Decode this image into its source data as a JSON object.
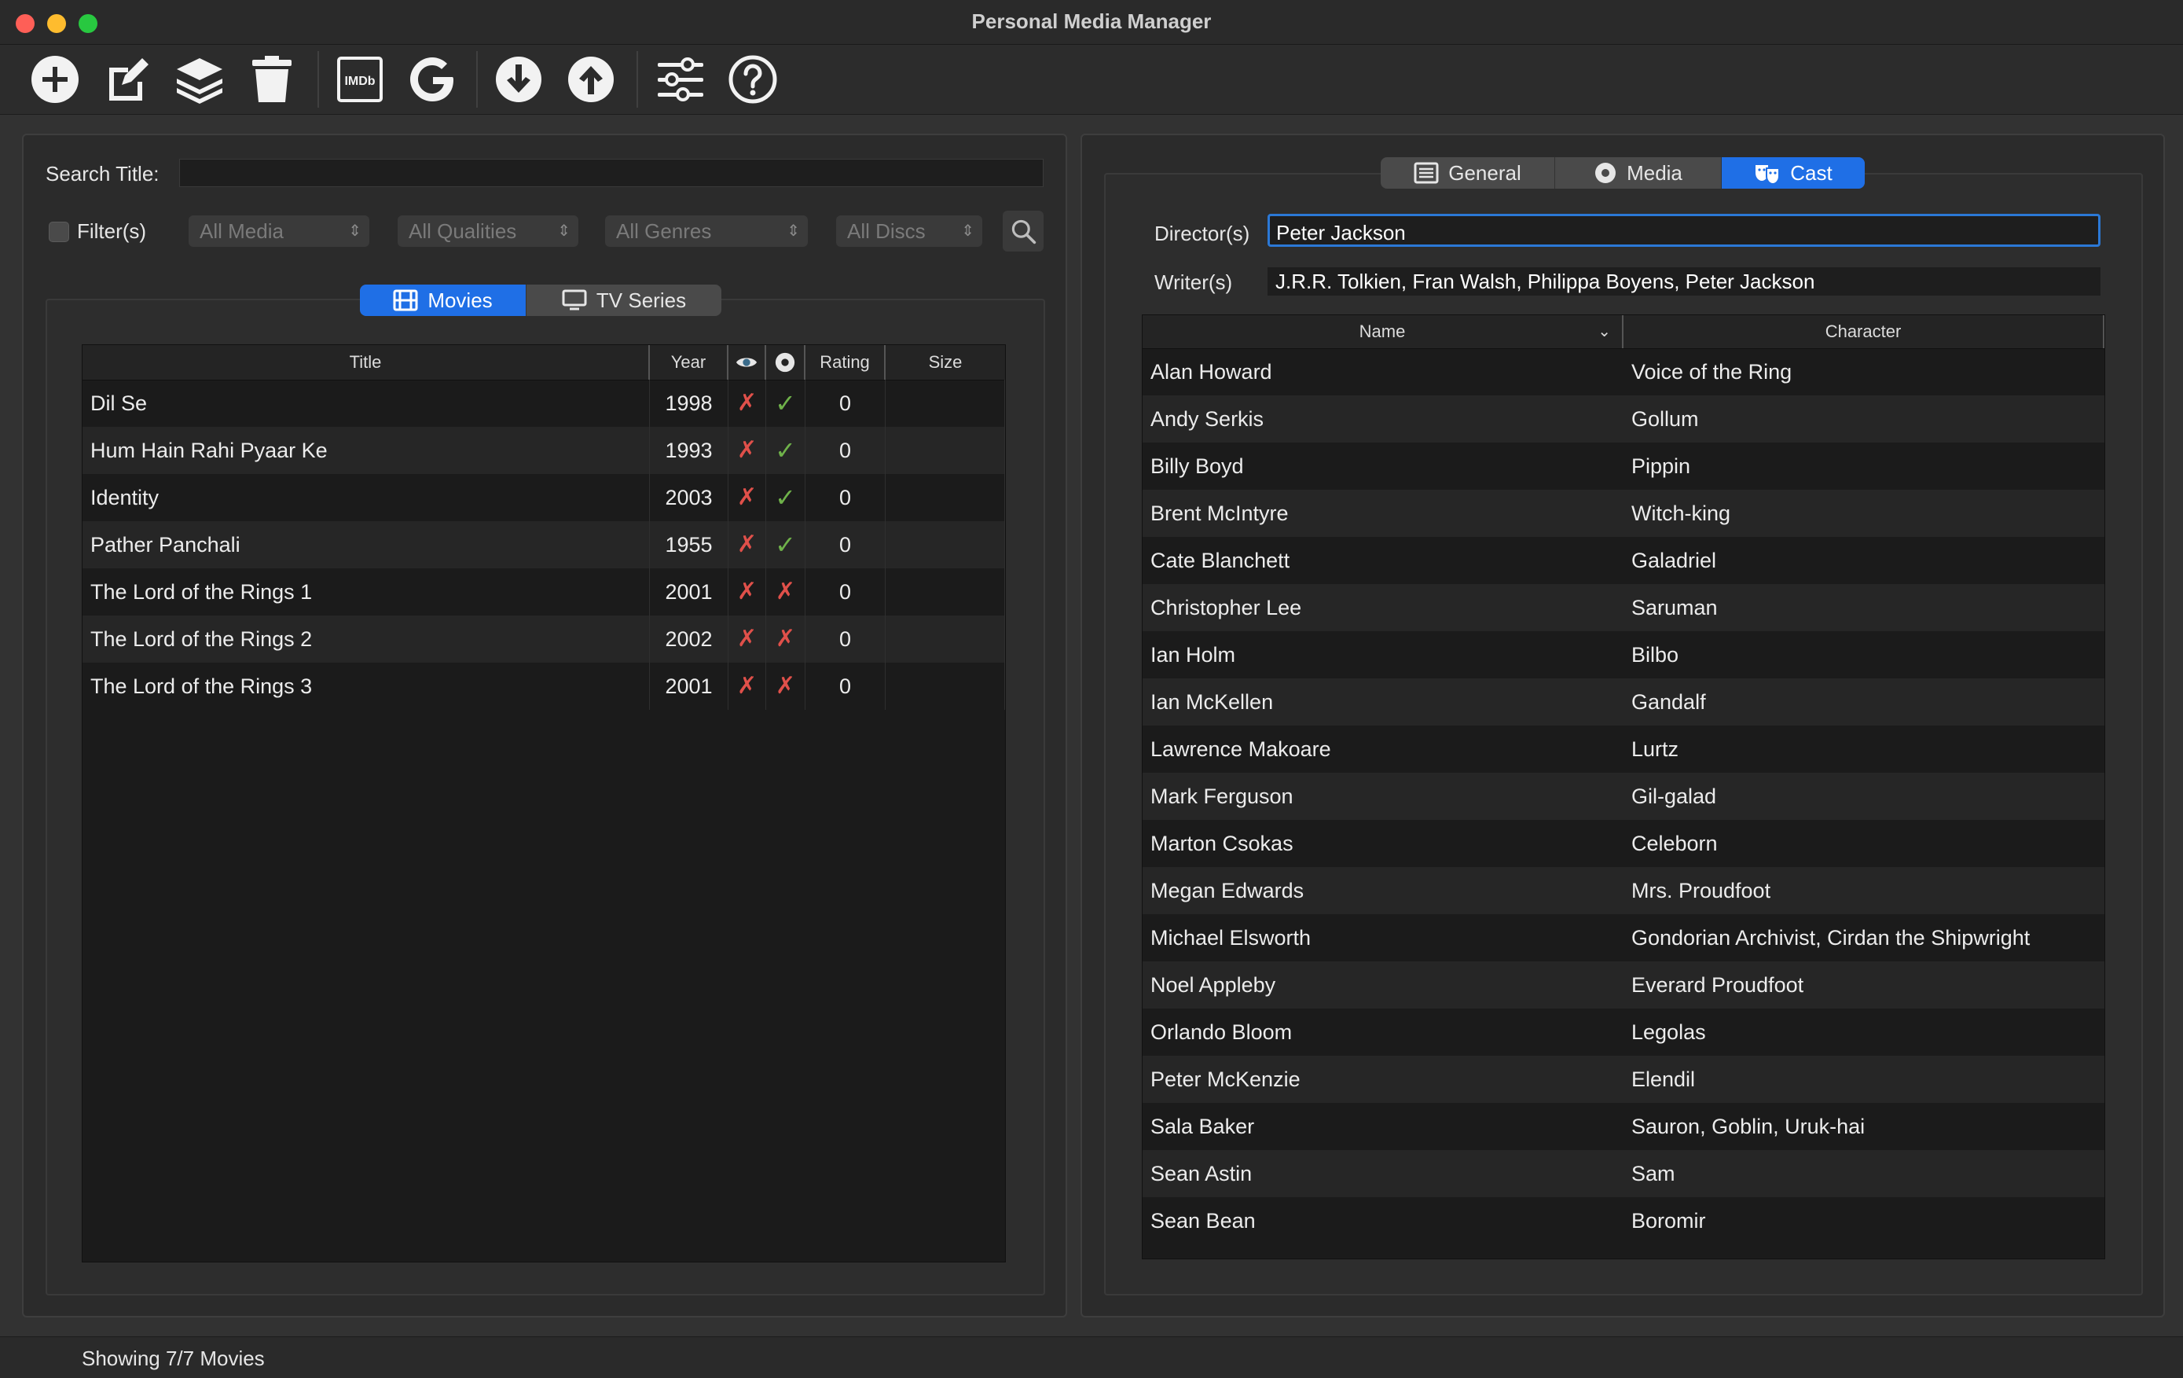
{
  "window": {
    "title": "Personal Media Manager"
  },
  "toolbar": {
    "buttons": [
      {
        "icon": "plus-circle-icon",
        "label": "Add"
      },
      {
        "icon": "edit-icon",
        "label": "Edit"
      },
      {
        "icon": "layers-icon",
        "label": "Collections"
      },
      {
        "icon": "trash-icon",
        "label": "Delete"
      },
      {
        "icon": "imdb-icon",
        "text": "IMDb"
      },
      {
        "icon": "google-icon",
        "text": "G"
      },
      {
        "icon": "download-icon",
        "label": "Download"
      },
      {
        "icon": "upload-icon",
        "label": "Upload"
      },
      {
        "icon": "sliders-icon",
        "label": "Settings"
      },
      {
        "icon": "help-icon",
        "label": "Help"
      }
    ]
  },
  "search": {
    "label": "Search Title:",
    "value": ""
  },
  "filters": {
    "label": "Filter(s)",
    "checked": false,
    "media": "All Media",
    "qualities": "All Qualities",
    "genres": "All Genres",
    "discs": "All Discs"
  },
  "library_tabs": {
    "movies": "Movies",
    "tv_series": "TV Series",
    "active": "movies"
  },
  "movie_table": {
    "headers": {
      "title": "Title",
      "year": "Year",
      "rating": "Rating",
      "size": "Size"
    },
    "rows": [
      {
        "title": "Dil Se",
        "year": "1998",
        "seen": false,
        "owned": true,
        "rating": "0",
        "size": ""
      },
      {
        "title": "Hum Hain Rahi Pyaar Ke",
        "year": "1993",
        "seen": false,
        "owned": true,
        "rating": "0",
        "size": ""
      },
      {
        "title": "Identity",
        "year": "2003",
        "seen": false,
        "owned": true,
        "rating": "0",
        "size": ""
      },
      {
        "title": "Pather Panchali",
        "year": "1955",
        "seen": false,
        "owned": true,
        "rating": "0",
        "size": ""
      },
      {
        "title": "The Lord of the Rings 1",
        "year": "2001",
        "seen": false,
        "owned": false,
        "rating": "0",
        "size": ""
      },
      {
        "title": "The Lord of the Rings 2",
        "year": "2002",
        "seen": false,
        "owned": false,
        "rating": "0",
        "size": ""
      },
      {
        "title": "The Lord of the Rings 3",
        "year": "2001",
        "seen": false,
        "owned": false,
        "rating": "0",
        "size": ""
      }
    ]
  },
  "detail_tabs": {
    "general": "General",
    "media": "Media",
    "cast": "Cast",
    "active": "cast"
  },
  "credits": {
    "directors_label": "Director(s)",
    "directors_value": "Peter Jackson",
    "writers_label": "Writer(s)",
    "writers_value": "J.R.R. Tolkien, Fran Walsh, Philippa Boyens, Peter Jackson"
  },
  "cast_table": {
    "headers": {
      "name": "Name",
      "character": "Character"
    },
    "rows": [
      {
        "name": "Alan Howard",
        "character": "Voice of the Ring"
      },
      {
        "name": "Andy Serkis",
        "character": "Gollum"
      },
      {
        "name": "Billy Boyd",
        "character": "Pippin"
      },
      {
        "name": "Brent McIntyre",
        "character": "Witch-king"
      },
      {
        "name": "Cate Blanchett",
        "character": "Galadriel"
      },
      {
        "name": "Christopher Lee",
        "character": "Saruman"
      },
      {
        "name": "Ian Holm",
        "character": "Bilbo"
      },
      {
        "name": "Ian McKellen",
        "character": "Gandalf"
      },
      {
        "name": "Lawrence Makoare",
        "character": "Lurtz"
      },
      {
        "name": "Mark Ferguson",
        "character": "Gil-galad"
      },
      {
        "name": "Marton Csokas",
        "character": "Celeborn"
      },
      {
        "name": "Megan Edwards",
        "character": "Mrs. Proudfoot"
      },
      {
        "name": "Michael Elsworth",
        "character": "Gondorian Archivist, Cirdan the Shipwright"
      },
      {
        "name": "Noel Appleby",
        "character": "Everard Proudfoot"
      },
      {
        "name": "Orlando Bloom",
        "character": "Legolas"
      },
      {
        "name": "Peter McKenzie",
        "character": "Elendil"
      },
      {
        "name": "Sala Baker",
        "character": "Sauron, Goblin, Uruk-hai"
      },
      {
        "name": "Sean Astin",
        "character": "Sam"
      },
      {
        "name": "Sean Bean",
        "character": "Boromir"
      }
    ]
  },
  "status": {
    "text": "Showing 7/7 Movies"
  },
  "colors": {
    "accent": "#1f6fe6",
    "cross": "#e0504a",
    "check": "#6fb24a"
  }
}
